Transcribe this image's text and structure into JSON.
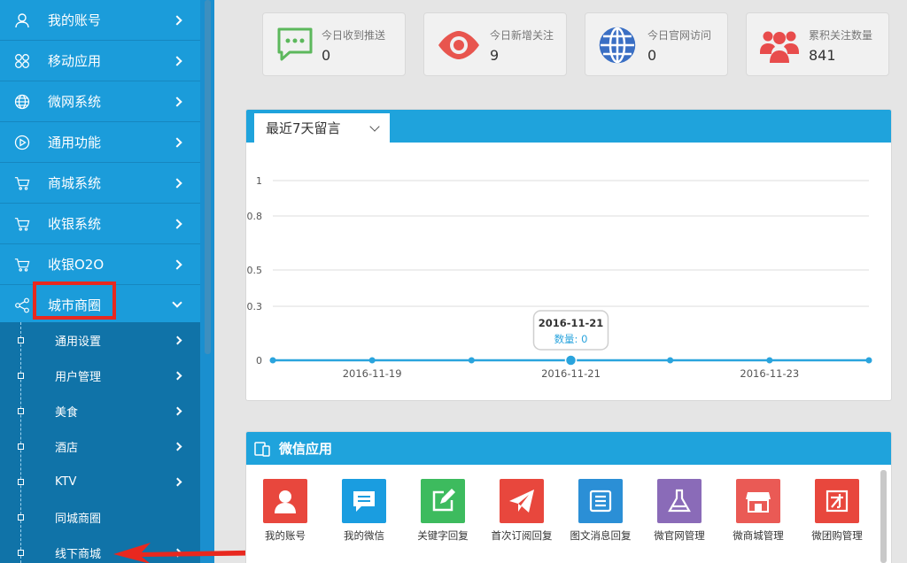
{
  "sidebar": {
    "menu": [
      {
        "label": "我的账号",
        "icon": "user-icon"
      },
      {
        "label": "移动应用",
        "icon": "apps-clover-icon"
      },
      {
        "label": "微网系统",
        "icon": "globe-icon"
      },
      {
        "label": "通用功能",
        "icon": "play-circle-icon"
      },
      {
        "label": "商城系统",
        "icon": "cart-icon"
      },
      {
        "label": "收银系统",
        "icon": "cart-icon"
      },
      {
        "label": "收银O2O",
        "icon": "cart-icon"
      },
      {
        "label": "城市商圈",
        "icon": "share-icon",
        "expanded": true
      }
    ],
    "submenu": [
      {
        "label": "通用设置",
        "has_chevron": true
      },
      {
        "label": "用户管理",
        "has_chevron": true
      },
      {
        "label": "美食",
        "has_chevron": true
      },
      {
        "label": "酒店",
        "has_chevron": true
      },
      {
        "label": "KTV",
        "has_chevron": true
      },
      {
        "label": "同城商圈",
        "has_chevron": false
      },
      {
        "label": "线下商城",
        "has_chevron": true
      }
    ]
  },
  "stats": [
    {
      "title": "今日收到推送",
      "value": "0",
      "icon": "message-icon",
      "color": "#5cb85c"
    },
    {
      "title": "今日新增关注",
      "value": "9",
      "icon": "eye-icon",
      "color": "#e8554e"
    },
    {
      "title": "今日官网访问",
      "value": "0",
      "icon": "globe-icon",
      "color": "#3a6fc4"
    },
    {
      "title": "累积关注数量",
      "value": "841",
      "icon": "users-icon",
      "color": "#e84c4c"
    }
  ],
  "chart_panel": {
    "select_value": "最近7天留言"
  },
  "chart_data": {
    "type": "line",
    "x": [
      "2016-11-18",
      "2016-11-19",
      "2016-11-20",
      "2016-11-21",
      "2016-11-22",
      "2016-11-23",
      "2016-11-24"
    ],
    "x_tick_labels": [
      "2016-11-19",
      "2016-11-21",
      "2016-11-23"
    ],
    "y_tick_labels": [
      "1",
      "0.8",
      "0.5",
      "0.3",
      "0"
    ],
    "series": [
      {
        "name": "数量",
        "values": [
          0,
          0,
          0,
          0,
          0,
          0,
          0
        ]
      }
    ],
    "ylim": [
      0,
      1
    ],
    "grid": true,
    "tooltip": {
      "title": "2016-11-21",
      "series": "数量",
      "value": 0
    }
  },
  "apps_panel": {
    "title": "微信应用",
    "apps": [
      {
        "label": "我的账号",
        "icon": "user-icon",
        "color": "#e8473d"
      },
      {
        "label": "我的微信",
        "icon": "chat-icon",
        "color": "#1a9de0"
      },
      {
        "label": "关键字回复",
        "icon": "edit-icon",
        "color": "#3dbb5e"
      },
      {
        "label": "首次订阅回复",
        "icon": "paper-plane-icon",
        "color": "#e8473d"
      },
      {
        "label": "图文消息回复",
        "icon": "list-icon",
        "color": "#2b8fd6"
      },
      {
        "label": "微官网管理",
        "icon": "flask-icon",
        "color": "#8a6bb8"
      },
      {
        "label": "微商城管理",
        "icon": "store-icon",
        "color": "#ea5a55"
      },
      {
        "label": "微团购管理",
        "icon": "group-buy-icon",
        "color": "#e8473d"
      }
    ]
  }
}
